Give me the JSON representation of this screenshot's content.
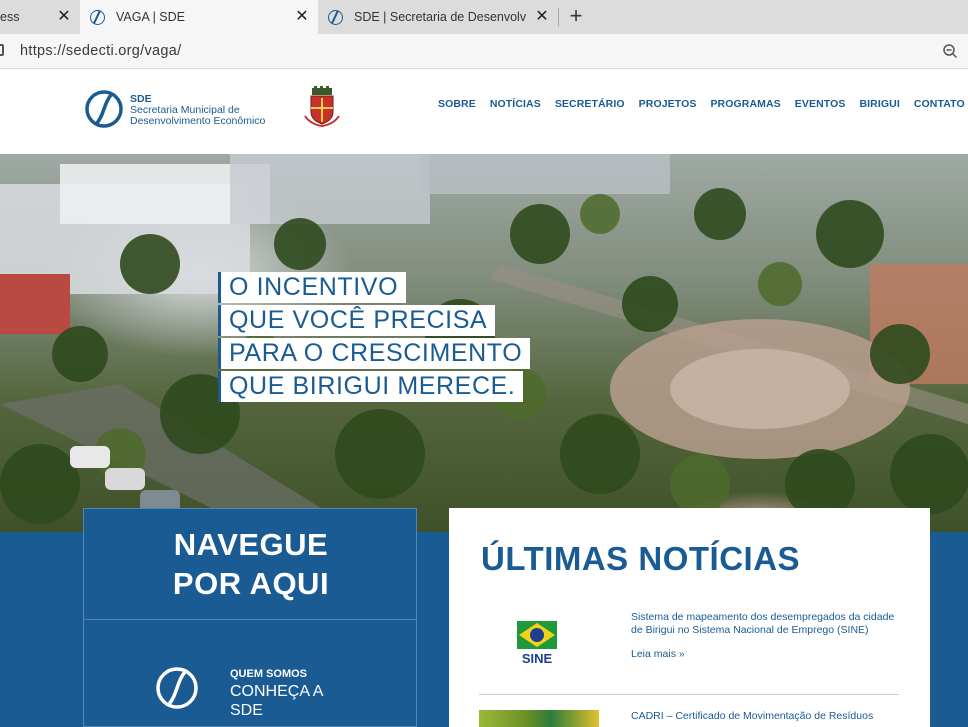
{
  "browser": {
    "tabs": [
      {
        "title": "ess"
      },
      {
        "title": "VAGA | SDE"
      },
      {
        "title": "SDE | Secretaria de Desenvolvime"
      }
    ],
    "url": "https://sedecti.org/vaga/"
  },
  "header": {
    "logo": {
      "abbr": "SDE",
      "line1": "Secretaria Municipal de",
      "line2": "Desenvolvimento Econômico"
    },
    "nav": [
      "SOBRE",
      "NOTÍCIAS",
      "SECRETÁRIO",
      "PROJETOS",
      "PROGRAMAS",
      "EVENTOS",
      "BIRIGUI",
      "CONTATO"
    ]
  },
  "hero": {
    "lines": [
      "O INCENTIVO",
      "QUE VOCÊ PRECISA",
      "PARA O CRESCIMENTO",
      "QUE BIRIGUI MERECE."
    ]
  },
  "navigate": {
    "title_line1": "NAVEGUE",
    "title_line2": "POR AQUI",
    "about_kicker": "QUEM SOMOS",
    "about_line1": "CONHEÇA A",
    "about_line2": "SDE"
  },
  "news": {
    "title": "ÚLTIMAS NOTÍCIAS",
    "items": [
      {
        "image_text": "SINE",
        "text": "Sistema de mapeamento dos desempregados da cidade de Birigui no Sistema Nacional de Emprego (SINE)",
        "read_more": "Leia mais »"
      },
      {
        "text": "CADRI – Certificado de Movimentação de Resíduos"
      }
    ]
  },
  "colors": {
    "brand": "#1a5b94",
    "tab_bar": "#dcdcdc"
  }
}
